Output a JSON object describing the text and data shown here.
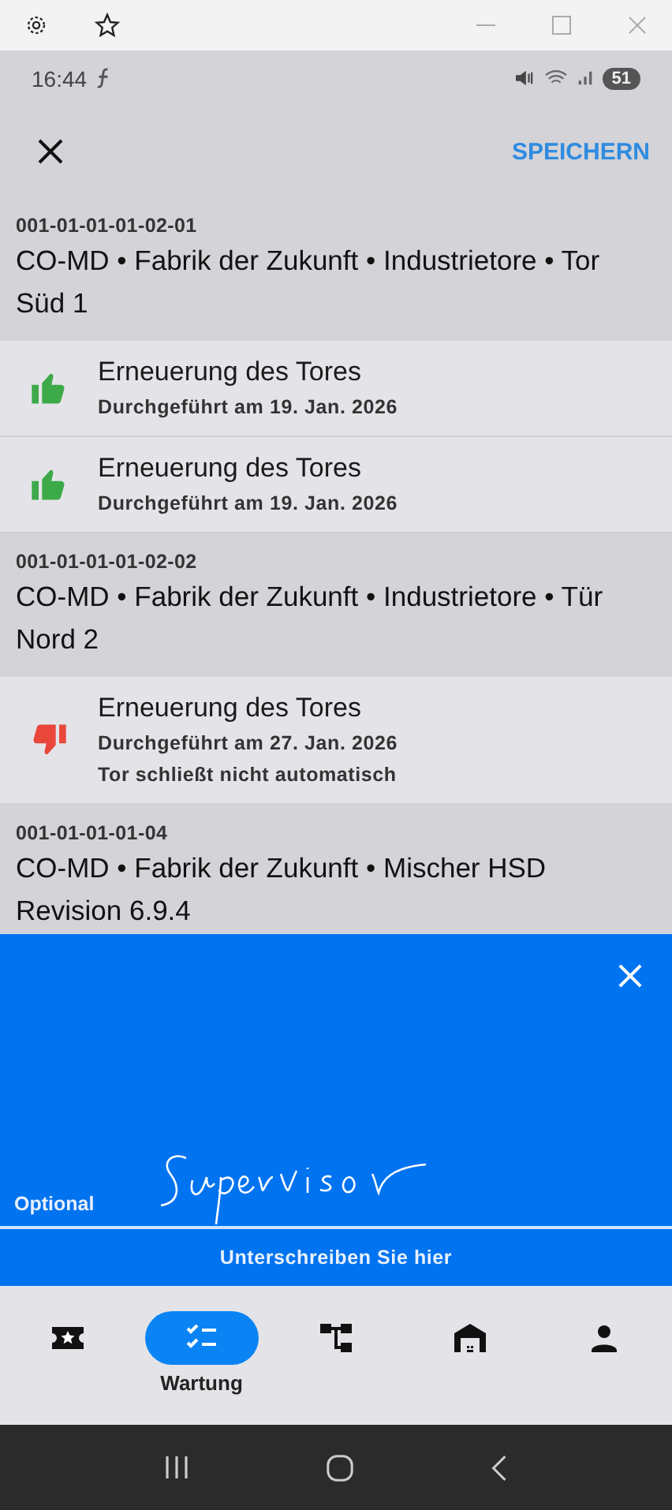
{
  "status_bar": {
    "time": "16:44",
    "battery": "51"
  },
  "app_bar": {
    "save": "SPEICHERN"
  },
  "groups": [
    {
      "code": "001-01-01-01-02-01",
      "title": "CO-MD • Fabrik der Zukunft • Industrietore • Tor Süd 1",
      "items": [
        {
          "kind": "pass",
          "title": "Erneuerung des Tores",
          "date": "Durchgeführt am 19. Jan. 2026"
        },
        {
          "kind": "pass",
          "title": "Erneuerung des Tores",
          "date": "Durchgeführt am 19. Jan. 2026"
        }
      ]
    },
    {
      "code": "001-01-01-01-02-02",
      "title": "CO-MD • Fabrik der Zukunft • Industrietore • Tür Nord 2",
      "items": [
        {
          "kind": "fail",
          "title": "Erneuerung des Tores",
          "date": "Durchgeführt am 27. Jan. 2026",
          "note": "Tor schließt nicht automatisch"
        }
      ]
    },
    {
      "code": "001-01-01-01-04",
      "title": "CO-MD • Fabrik der Zukunft • Mischer  HSD Revision 6.9.4"
    }
  ],
  "signature": {
    "label": "Optional",
    "hint": "Unterschreiben Sie hier"
  },
  "nav": [
    {
      "kind": "ticket",
      "selected": false
    },
    {
      "kind": "checklist",
      "label": "Wartung",
      "selected": true
    },
    {
      "kind": "hierarchy",
      "selected": false
    },
    {
      "kind": "garage",
      "selected": false
    },
    {
      "kind": "person",
      "selected": false
    }
  ]
}
